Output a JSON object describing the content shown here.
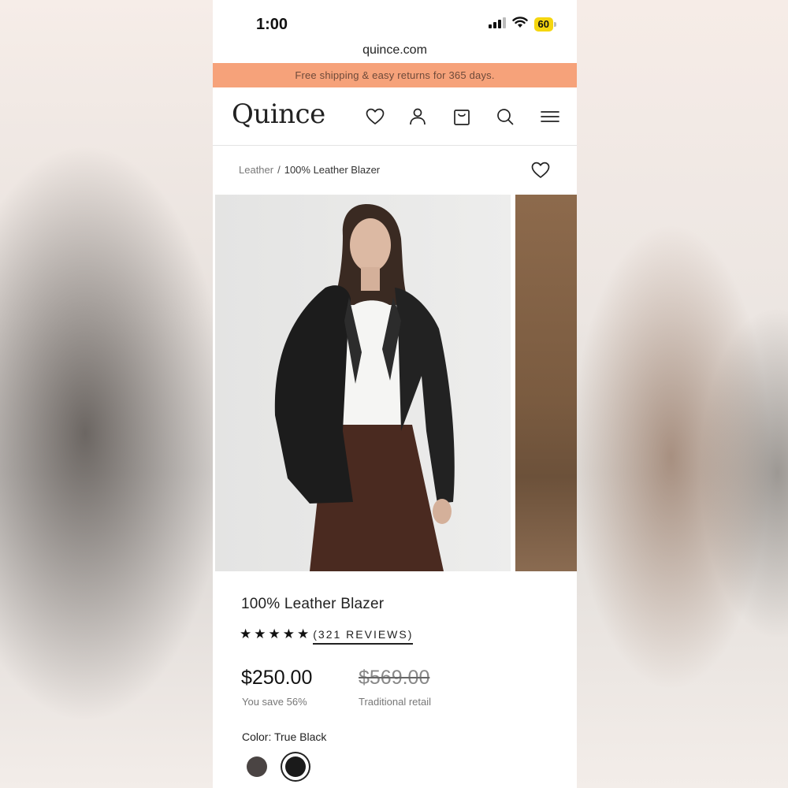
{
  "status_bar": {
    "time": "1:00",
    "battery": "60"
  },
  "browser": {
    "url": "quince.com"
  },
  "promo_banner": {
    "text": "Free shipping & easy returns for 365 days."
  },
  "header": {
    "logo": "Quince",
    "icons": [
      "heart-icon",
      "account-icon",
      "bag-icon",
      "search-icon",
      "menu-icon"
    ]
  },
  "breadcrumb": {
    "category": "Leather",
    "separator": "/",
    "current": "100% Leather Blazer"
  },
  "product": {
    "title": "100% Leather Blazer",
    "rating_stars": 5,
    "reviews": "(321 REVIEWS)",
    "price": "$250.00",
    "savings": "You save 56%",
    "retail_price": "$569.00",
    "retail_label": "Traditional retail",
    "color_label": "Color: True Black",
    "swatches": [
      {
        "color": "#4a4443",
        "selected": false
      },
      {
        "color": "#1a1a1a",
        "selected": true
      }
    ]
  },
  "colors": {
    "promo_bg": "#f6a27a",
    "accent_text": "#222222"
  }
}
